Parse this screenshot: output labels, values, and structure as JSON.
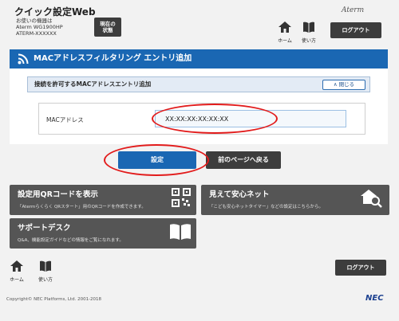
{
  "header": {
    "app_title": "クイック設定Web",
    "device_line1": "お使いの機器は",
    "device_line2": "Aterm WG1900HP",
    "device_line3": "ATERM-XXXXXX",
    "status_line1": "現在の",
    "status_line2": "状態",
    "brand": "Aterm",
    "home_label": "ホーム",
    "howto_label": "使い方",
    "logout_label": "ログアウト"
  },
  "section": {
    "title": "MACアドレスフィルタリング エントリ追加"
  },
  "panel": {
    "subtitle": "接続を許可するMACアドレスエントリ追加",
    "close_label": "閉じる",
    "mac_label": "MACアドレス",
    "mac_value": "XX:XX:XX:XX:XX:XX"
  },
  "actions": {
    "set_label": "設定",
    "back_label": "前のページへ戻る"
  },
  "tiles": [
    {
      "title": "設定用QRコードを表示",
      "desc": "「Atermらくらく QRスタート」用のQRコードを作成できます。"
    },
    {
      "title": "見えて安心ネット",
      "desc": "「こども安心ネットタイマー」などの設定はこちらから。"
    },
    {
      "title": "サポートデスク",
      "desc": "Q&A、機能設定ガイドなどの情報をご覧になれます。"
    }
  ],
  "footer": {
    "home_label": "ホーム",
    "howto_label": "使い方",
    "logout_label": "ログアウト",
    "copyright": "Copyright© NEC Platforms, Ltd. 2001-2018",
    "nec": "NEC"
  },
  "colors": {
    "accent": "#1a67b3",
    "dark_button": "#3d3d3d",
    "tile": "#555555",
    "highlight": "#e21b1b"
  }
}
